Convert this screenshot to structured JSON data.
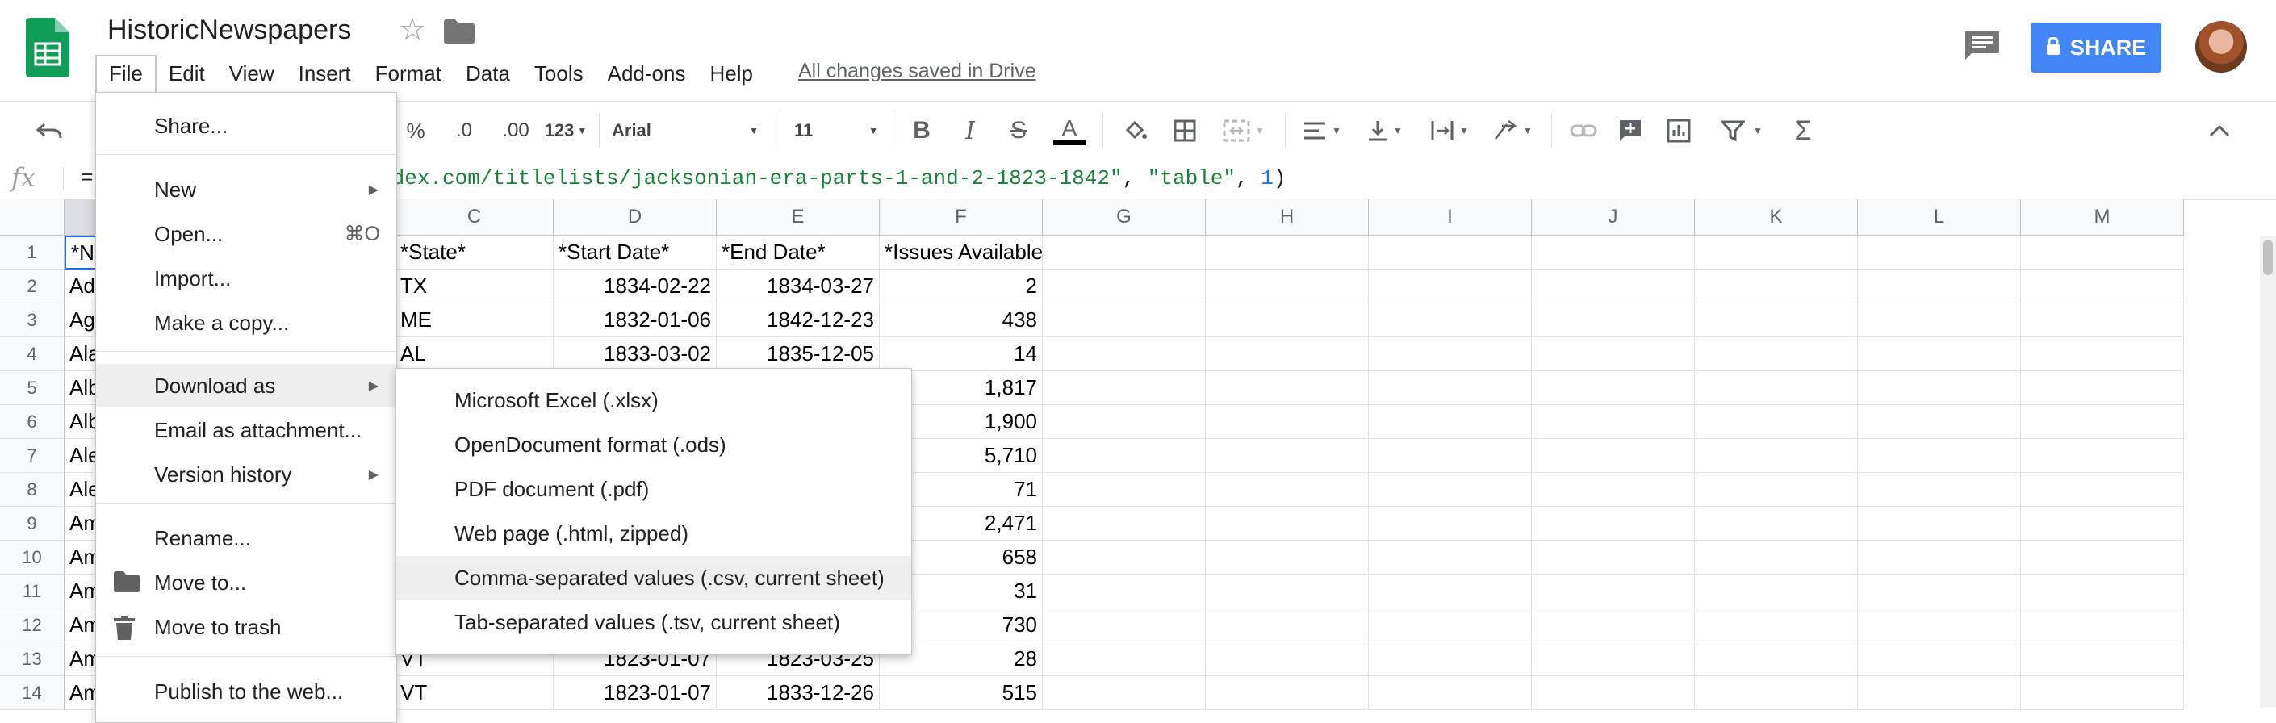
{
  "header": {
    "title": "HistoricNewspapers",
    "saved_status": "All changes saved in Drive",
    "share_label": "SHARE",
    "icons": [
      "sheets-logo-icon",
      "star-icon",
      "folder-icon",
      "comment-icon",
      "lock-icon",
      "avatar"
    ]
  },
  "menubar": [
    "File",
    "Edit",
    "View",
    "Insert",
    "Format",
    "Data",
    "Tools",
    "Add-ons",
    "Help"
  ],
  "toolbar": {
    "percent": "%",
    "decrease_decimals": ".0",
    "increase_decimals": ".00",
    "more_formats": "123",
    "font": "Arial",
    "font_size": "11",
    "bold": "B",
    "italic": "I",
    "strike": "S",
    "text_color": "A"
  },
  "formula_bar": {
    "fx": "fx",
    "prefix": "=",
    "url_part": "dex.com/titlelists/jacksonian-era-parts-1-and-2-1823-1842\"",
    "sep1": ", ",
    "arg2": "\"table\"",
    "sep2": ", ",
    "arg3": "1",
    "suffix": ")"
  },
  "grid": {
    "columns": [
      "C",
      "D",
      "E",
      "F",
      "G",
      "H",
      "I",
      "J",
      "K",
      "L",
      "M"
    ],
    "row_numbers": [
      "1",
      "2",
      "3",
      "4",
      "5",
      "6",
      "7",
      "8",
      "9",
      "10",
      "11",
      "12",
      "13",
      "14"
    ],
    "col_a_visible": [
      "*N",
      "Ad",
      "Ag",
      "Ala",
      "Alb",
      "Alb",
      "Ale",
      "Ale",
      "Am",
      "Am",
      "Am",
      "Am",
      "Am",
      "Am"
    ],
    "col_c": [
      "*State*",
      "TX",
      "ME",
      "AL",
      "",
      "",
      "",
      "",
      "",
      "",
      "",
      "",
      "VT",
      "VT"
    ],
    "col_d": [
      "*Start Date*",
      "1834-02-22",
      "1832-01-06",
      "1833-03-02",
      "",
      "",
      "",
      "",
      "",
      "",
      "",
      "",
      "1823-01-07",
      "1823-01-07"
    ],
    "col_e": [
      "*End Date*",
      "1834-03-27",
      "1842-12-23",
      "1835-12-05",
      "",
      "",
      "",
      "",
      "",
      "",
      "",
      "",
      "1823-03-25",
      "1833-12-26"
    ],
    "col_f": [
      "*Issues Available*",
      "2",
      "438",
      "14",
      "1,817",
      "1,900",
      "5,710",
      "71",
      "2,471",
      "658",
      "31",
      "730",
      "28",
      "515"
    ]
  },
  "file_menu": {
    "items": [
      {
        "label": "Share..."
      },
      {
        "label": "New",
        "submenu": true
      },
      {
        "label": "Open...",
        "shortcut": "⌘O"
      },
      {
        "label": "Import..."
      },
      {
        "label": "Make a copy..."
      },
      {
        "label": "Download as",
        "submenu": true
      },
      {
        "label": "Email as attachment..."
      },
      {
        "label": "Version history",
        "submenu": true
      },
      {
        "label": "Rename..."
      },
      {
        "label": "Move to..."
      },
      {
        "label": "Move to trash"
      },
      {
        "label": "Publish to the web..."
      }
    ]
  },
  "download_submenu": {
    "items": [
      "Microsoft Excel (.xlsx)",
      "OpenDocument format (.ods)",
      "PDF document (.pdf)",
      "Web page (.html, zipped)",
      "Comma-separated values (.csv, current sheet)",
      "Tab-separated values (.tsv, current sheet)"
    ]
  },
  "colors": {
    "share_button": "#4285f4",
    "sheets_green": "#0f9d58",
    "formula_string": "#188038",
    "formula_number": "#1a73e8",
    "menu_highlight": "#eeeeee"
  }
}
